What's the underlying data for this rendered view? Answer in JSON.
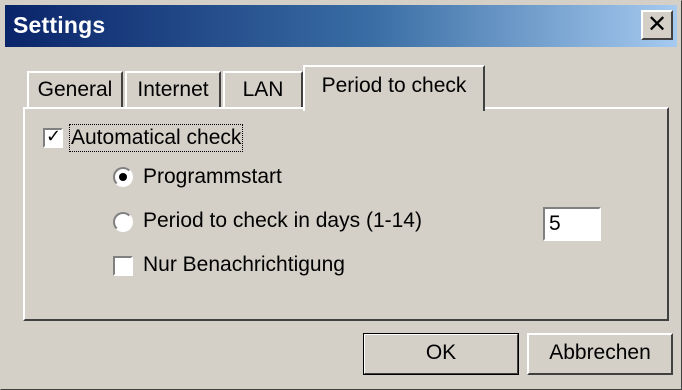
{
  "window": {
    "title": "Settings",
    "close_glyph": "✕"
  },
  "tabs": [
    {
      "label": "General",
      "active": false
    },
    {
      "label": "Internet",
      "active": false
    },
    {
      "label": "LAN",
      "active": false
    },
    {
      "label": "Period to check",
      "active": true
    }
  ],
  "panel": {
    "auto_check": {
      "label": "Automatical check",
      "checked": true
    },
    "radio_programmstart": {
      "label": "Programmstart",
      "selected": true
    },
    "radio_period": {
      "label": "Period to check in days (1-14)",
      "selected": false
    },
    "period_days_value": "5",
    "notify_only": {
      "label": "Nur Benachrichtigung",
      "checked": false
    }
  },
  "buttons": {
    "ok_label": "OK",
    "cancel_label": "Abbrechen"
  },
  "colors": {
    "face": "#d4d0c8",
    "title_start": "#0a246a",
    "title_end": "#a6caf0"
  },
  "icons": {
    "close": "close-icon",
    "check": "checkmark-icon"
  }
}
